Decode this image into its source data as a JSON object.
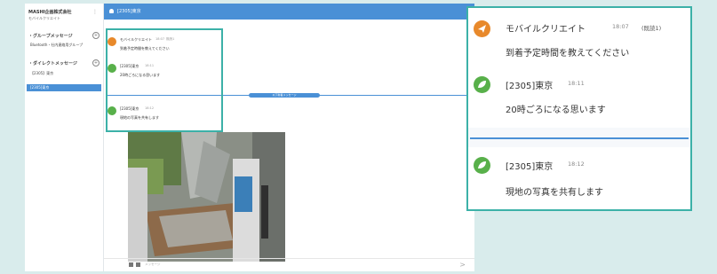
{
  "sidebar": {
    "workspace_title": "MASHI企画株式会社",
    "workspace_sub": "モバイルクリエイト",
    "group_section": "・グループメッセージ",
    "group_item": "Bluetooth・社内連絡用グループ",
    "direct_section": "・ダイレクトメッセージ",
    "direct_items": [
      "【2305】東京"
    ],
    "active_item": "[2305]東京"
  },
  "header": {
    "title": "[2305]東京"
  },
  "mini_chat": {
    "messages": [
      {
        "name": "モバイルクリエイト",
        "time": "18:07",
        "badge": "既読1",
        "text": "到着予定時間を教えてください"
      },
      {
        "name": "[2305]東京",
        "time": "18:11",
        "text": "20時ごろになる思います"
      },
      {
        "name": "[2305]東京",
        "time": "18:12",
        "text": "現地の写真を共有します"
      }
    ],
    "divider_label": "以下新着メッセージ"
  },
  "composer": {
    "placeholder": "メッセージ",
    "send_icon": "send-icon"
  },
  "zoom": {
    "messages": [
      {
        "name": "モバイルクリエイト",
        "time": "18:07",
        "badge": "(既読1)",
        "text": "到着予定時間を教えてください"
      },
      {
        "name": "[2305]東京",
        "time": "18:11",
        "text": "20時ごろになる思います"
      },
      {
        "name": "[2305]東京",
        "time": "18:12",
        "text": "現地の写真を共有します"
      }
    ]
  },
  "colors": {
    "accent": "#4a90d6",
    "highlight": "#3cb1a8",
    "orange": "#e8892b",
    "green": "#58b04a",
    "background": "#d9ecec"
  }
}
